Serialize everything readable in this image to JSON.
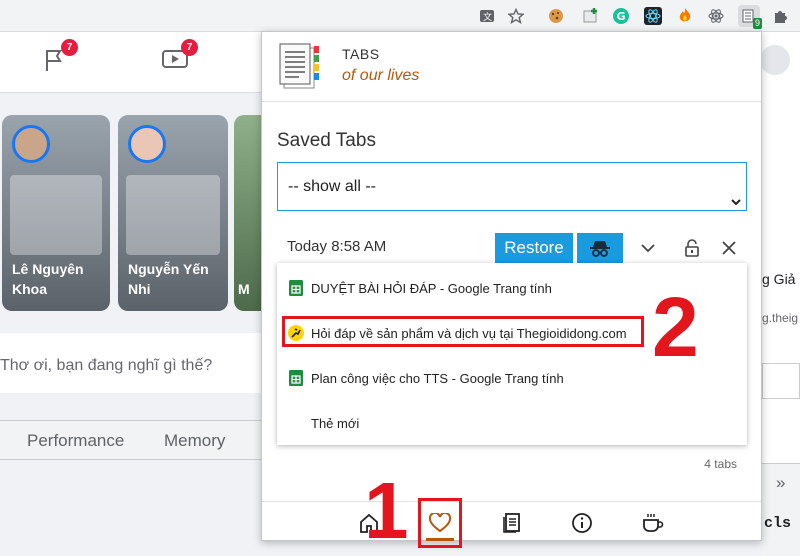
{
  "toolbar": {
    "icons": [
      "translate-icon",
      "star-icon",
      "cookie-icon",
      "plus-icon",
      "grammarly-icon",
      "react-icon",
      "fire-icon",
      "atom-icon",
      "tabs-extension-icon",
      "puzzle-icon"
    ],
    "extension_badge": "9"
  },
  "background": {
    "nav_badges": [
      "7",
      "7"
    ],
    "stories": [
      {
        "name": "Lê Nguyên Khoa"
      },
      {
        "name": "Nguyễn Yến Nhi"
      },
      {
        "name": "M"
      }
    ],
    "post_prompt": "Thơ ơi, bạn đang nghĩ gì thế?",
    "devtools_tabs": [
      "Performance",
      "Memory"
    ],
    "right_texts": [
      "g Giả",
      "g.theig",
      "cls"
    ]
  },
  "popup": {
    "brand_line1": "TABS",
    "brand_line2": "of our lives",
    "saved_title": "Saved Tabs",
    "filter_selected": "-- show all --",
    "group": {
      "time": "Today 8:58 AM",
      "restore_label": "Restore",
      "tabs": [
        {
          "title": "DUYỆT BÀI HỎI ĐÁP - Google Trang tính",
          "icon": "google-sheets-icon"
        },
        {
          "title": "Hỏi đáp về sản phẩm và dịch vụ tại Thegioididong.com",
          "icon": "thegioididong-icon"
        },
        {
          "title": "Plan công việc cho TTS - Google Trang tính",
          "icon": "google-sheets-icon"
        },
        {
          "title": "Thẻ mới",
          "icon": ""
        }
      ],
      "count_label": "4 tabs"
    },
    "footer_icons": [
      "home-icon",
      "heart-icon",
      "notes-icon",
      "info-icon",
      "coffee-icon"
    ]
  },
  "annotations": {
    "step1": "1",
    "step2": "2"
  },
  "colors": {
    "accent_blue": "#1a9be0",
    "brand_orange": "#b8560a",
    "annotation_red": "#e3161e",
    "sheets_green": "#1e8e3e"
  }
}
